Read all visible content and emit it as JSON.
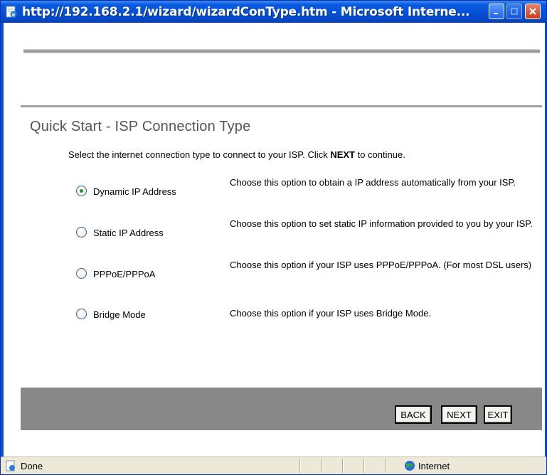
{
  "window": {
    "title": "http://192.168.2.1/wizard/wizardConType.htm - Microsoft Interne...",
    "icon": "ie-page-icon"
  },
  "page": {
    "heading": "Quick Start - ISP Connection Type",
    "intro_before": "Select the internet connection type to connect to your ISP. Click ",
    "intro_bold": "NEXT",
    "intro_after": " to continue.",
    "options": [
      {
        "label": "Dynamic IP Address",
        "description": "Choose this option to obtain a IP address automatically from your ISP.",
        "checked": true
      },
      {
        "label": "Static IP Address",
        "description": "Choose this option to set static IP information provided to you by your ISP.",
        "checked": false
      },
      {
        "label": "PPPoE/PPPoA",
        "description": "Choose this option if your ISP uses PPPoE/PPPoA. (For most DSL users)",
        "checked": false
      },
      {
        "label": "Bridge Mode",
        "description": "Choose this option if your ISP uses Bridge Mode.",
        "checked": false
      }
    ],
    "buttons": {
      "back": "BACK",
      "next": "NEXT",
      "exit": "EXIT"
    }
  },
  "statusbar": {
    "status": "Done",
    "zone": "Internet"
  },
  "colors": {
    "titlebar": "#0450d8",
    "button_bar": "#888888",
    "heading": "#555555",
    "radio_dot": "#2f8d2f"
  }
}
